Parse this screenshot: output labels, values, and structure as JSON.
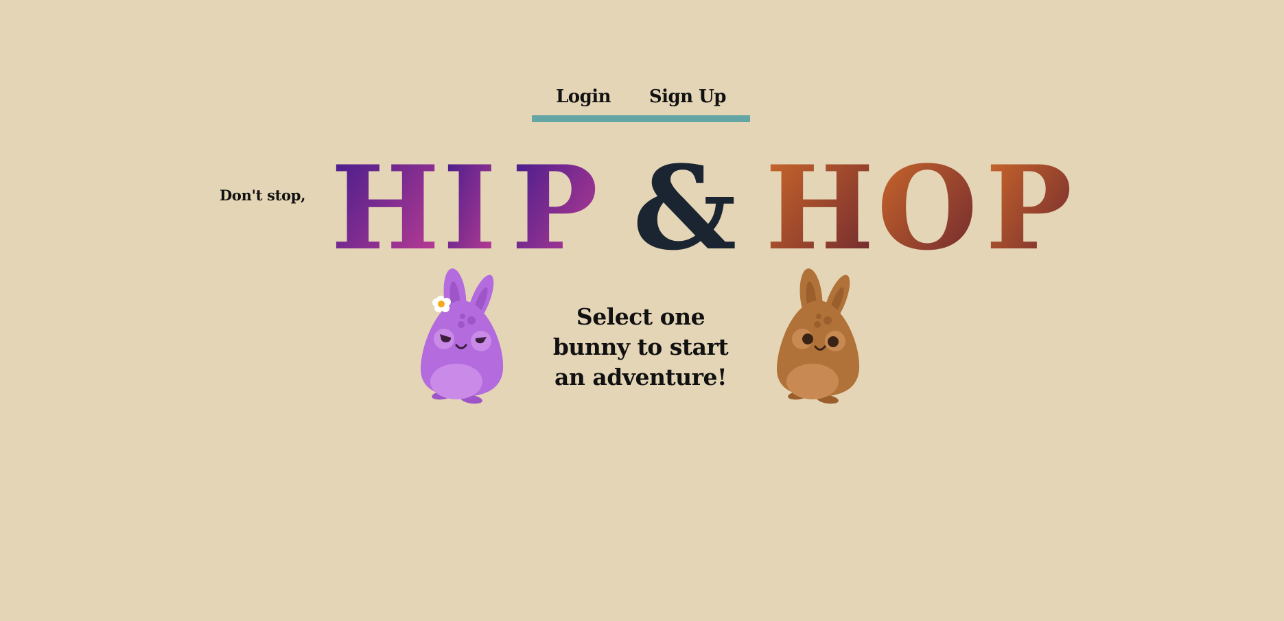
{
  "nav": {
    "login_label": "Login",
    "signup_label": "Sign Up",
    "underline_color": "#64a6a6"
  },
  "tagline": "Don't stop,",
  "title": {
    "hip": [
      "H",
      "I",
      "P"
    ],
    "amp": "&",
    "hop": [
      "H",
      "O",
      "P"
    ],
    "hip_gradient": [
      "#3d1a8c",
      "#c43f93"
    ],
    "amp_color": "#1b2532",
    "hop_gradient": [
      "#d06b2a",
      "#6a2530"
    ]
  },
  "prompt": "Select one bunny to start an adventure!",
  "bunnies": [
    {
      "name": "purple-bunny",
      "color": "#b36bdd",
      "accessory": "flower"
    },
    {
      "name": "brown-bunny",
      "color": "#b07238"
    }
  ],
  "background_color": "#e4d5b7"
}
